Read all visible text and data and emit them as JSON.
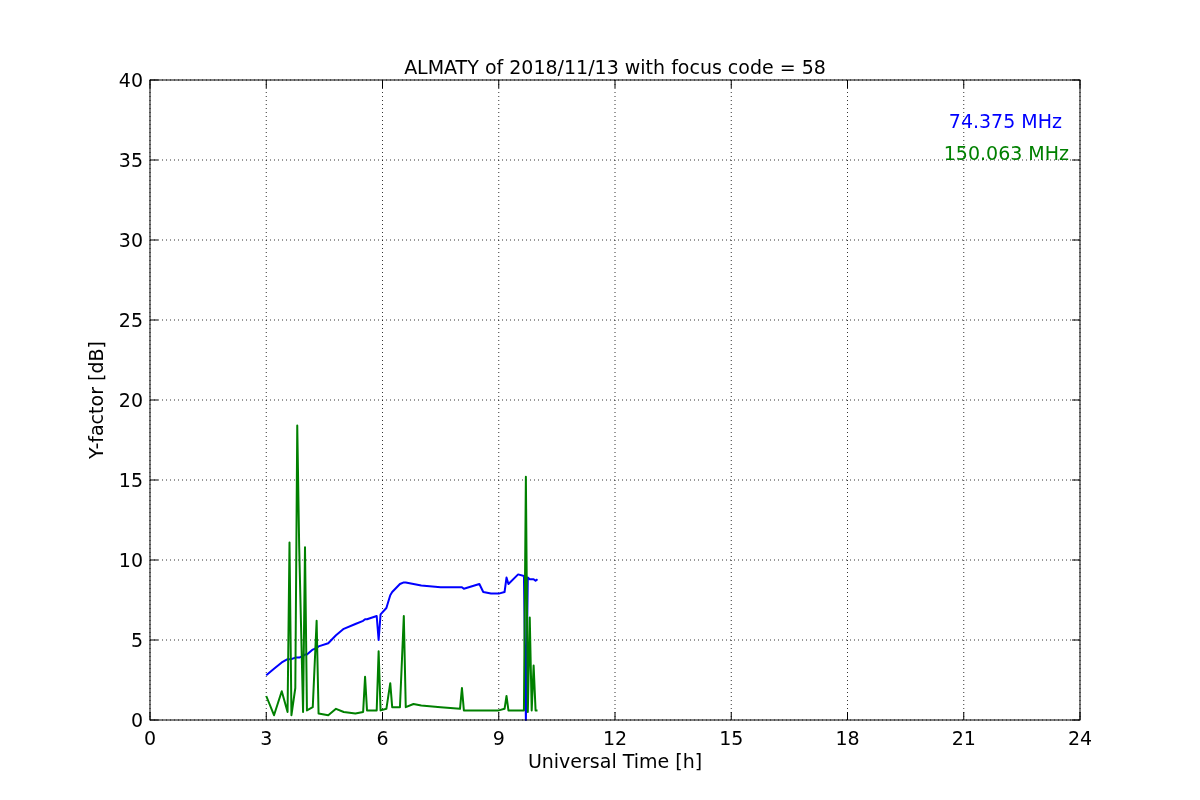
{
  "chart_data": {
    "type": "line",
    "title": "ALMATY of 2018/11/13 with focus code = 58",
    "xlabel": "Universal Time [h]",
    "ylabel": "Y-factor [dB]",
    "x": [
      3.0,
      3.2,
      3.4,
      3.55,
      3.6,
      3.65,
      3.75,
      3.8,
      3.85,
      3.95,
      4.0,
      4.05,
      4.2,
      4.3,
      4.35,
      4.6,
      4.8,
      5.0,
      5.3,
      5.5,
      5.55,
      5.6,
      5.85,
      5.9,
      5.95,
      6.1,
      6.2,
      6.25,
      6.45,
      6.55,
      6.6,
      6.8,
      7.0,
      7.5,
      8.0,
      8.05,
      8.1,
      8.5,
      8.6,
      8.8,
      9.0,
      9.15,
      9.2,
      9.25,
      9.5,
      9.65,
      9.7,
      9.75,
      9.8,
      9.85,
      9.9,
      9.95,
      10.0
    ],
    "series": [
      {
        "name": "74.375 MHz",
        "color": "#0000ff",
        "values": [
          2.8,
          3.2,
          3.6,
          3.8,
          3.8,
          3.8,
          3.9,
          3.9,
          3.9,
          4.0,
          4.1,
          4.1,
          4.4,
          4.5,
          4.6,
          4.8,
          5.3,
          5.7,
          6.0,
          6.2,
          6.3,
          6.3,
          6.5,
          5.0,
          6.6,
          7.0,
          7.8,
          8.0,
          8.5,
          8.6,
          8.6,
          8.5,
          8.4,
          8.3,
          8.3,
          8.3,
          8.2,
          8.5,
          8.0,
          7.9,
          7.9,
          8.0,
          8.9,
          8.5,
          9.1,
          9.0,
          0,
          8.9,
          8.8,
          8.8,
          8.8,
          8.7,
          8.8
        ]
      },
      {
        "name": "150.063 MHz",
        "color": "#008000",
        "values": [
          1.5,
          0.3,
          1.8,
          0.5,
          11.1,
          0.3,
          2.0,
          18.4,
          10.8,
          0.5,
          10.8,
          0.6,
          0.8,
          6.2,
          0.4,
          0.3,
          0.7,
          0.5,
          0.4,
          0.5,
          2.7,
          0.6,
          0.6,
          4.3,
          0.6,
          0.7,
          2.3,
          0.8,
          0.8,
          6.5,
          0.8,
          1.0,
          0.9,
          0.8,
          0.7,
          2.0,
          0.6,
          0.6,
          0.6,
          0.6,
          0.6,
          0.7,
          1.5,
          0.6,
          0.6,
          0.6,
          15.2,
          0.5,
          6.4,
          0.6,
          3.4,
          0.6,
          0.6
        ]
      }
    ],
    "grid": true,
    "xlim": [
      0,
      24
    ],
    "ylim": [
      0,
      40
    ],
    "xticks": [
      0,
      3,
      6,
      9,
      12,
      15,
      18,
      21,
      24
    ],
    "yticks": [
      0,
      5,
      10,
      15,
      20,
      25,
      30,
      35,
      40
    ]
  }
}
